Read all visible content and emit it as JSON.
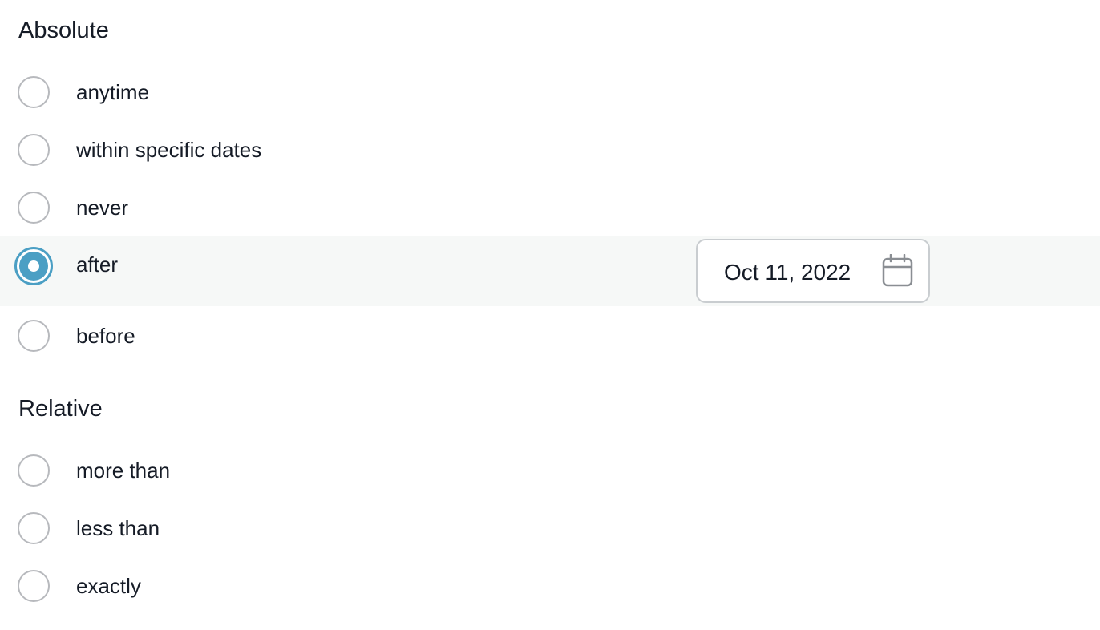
{
  "absolute": {
    "heading": "Absolute",
    "options": [
      {
        "label": "anytime",
        "selected": false
      },
      {
        "label": "within specific dates",
        "selected": false
      },
      {
        "label": "never",
        "selected": false
      },
      {
        "label": "after",
        "selected": true
      },
      {
        "label": "before",
        "selected": false
      }
    ]
  },
  "date_field": {
    "value": "Oct 11, 2022",
    "icon": "calendar-icon"
  },
  "relative": {
    "heading": "Relative",
    "options": [
      {
        "label": "more than",
        "selected": false
      },
      {
        "label": "less than",
        "selected": false
      },
      {
        "label": "exactly",
        "selected": false
      }
    ]
  },
  "colors": {
    "accent": "#4b9fc4",
    "selected_row_background": "#f6f8f7",
    "radio_border": "#b7b9bd",
    "text": "#151b26"
  }
}
